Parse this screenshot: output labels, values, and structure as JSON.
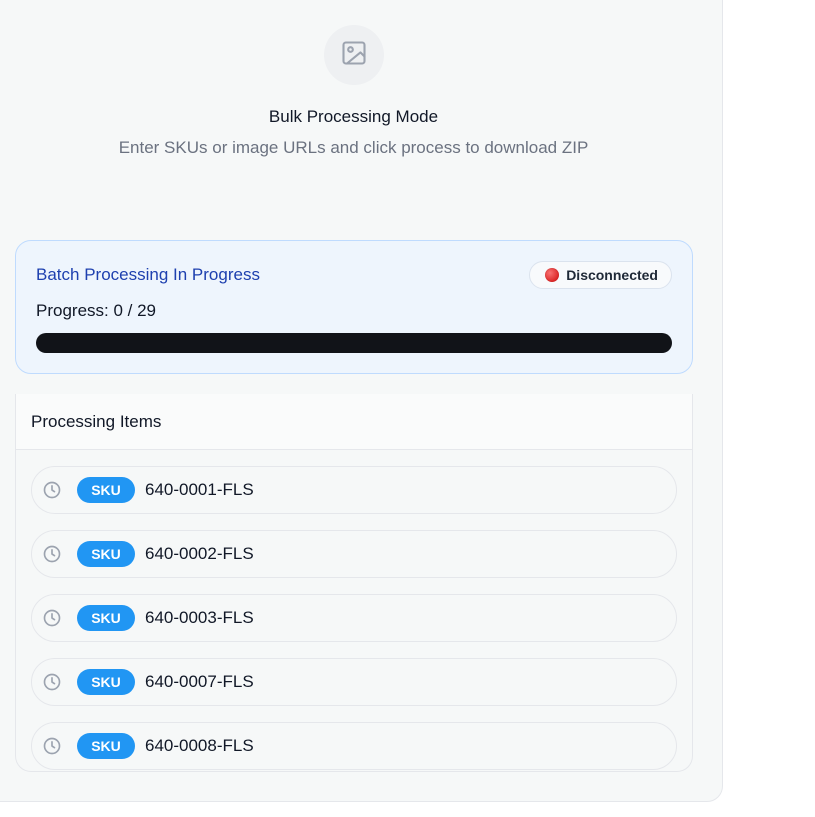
{
  "empty_state": {
    "icon": "image-icon",
    "title": "Bulk Processing Mode",
    "subtitle": "Enter SKUs or image URLs and click process to download ZIP"
  },
  "batch": {
    "title": "Batch Processing In Progress",
    "connection_status": "Disconnected",
    "connection_color": "#dc2626",
    "progress_label": "Progress: 0 / 29",
    "progress_fraction": 0
  },
  "items_panel": {
    "header": "Processing Items",
    "items": [
      {
        "status_icon": "clock-icon",
        "type": "SKU",
        "value": "640-0001-FLS"
      },
      {
        "status_icon": "clock-icon",
        "type": "SKU",
        "value": "640-0002-FLS"
      },
      {
        "status_icon": "clock-icon",
        "type": "SKU",
        "value": "640-0003-FLS"
      },
      {
        "status_icon": "clock-icon",
        "type": "SKU",
        "value": "640-0007-FLS"
      },
      {
        "status_icon": "clock-icon",
        "type": "SKU",
        "value": "640-0008-FLS"
      }
    ]
  },
  "colors": {
    "accent": "#2196f3",
    "batch_title": "#1e40af",
    "progress_track": "#111318"
  }
}
